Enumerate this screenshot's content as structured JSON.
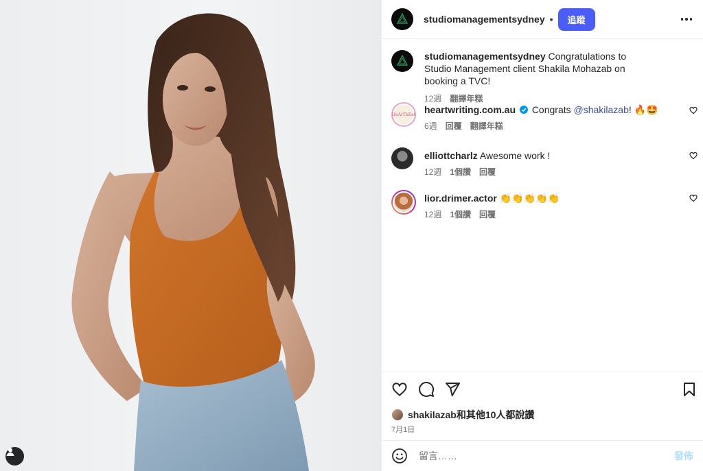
{
  "post": {
    "author": "studiomanagementsydney",
    "dot": "•",
    "follow_label": "追蹤",
    "caption_text": "Congratulations to Studio Management client Shakila Mohazab on booking a TVC!",
    "caption_time": "12週",
    "caption_translate": "翻譯年糕"
  },
  "comments": [
    {
      "user": "heartwriting.com.au",
      "verified": true,
      "text": "Congrats ",
      "mention": "@shakilazab",
      "suffix": "! 🔥🤩",
      "time": "6週",
      "reply": "回覆",
      "translate": "翻譯年糕",
      "avatar_label": "HeArTbEat"
    },
    {
      "user": "elliottcharlz",
      "text": "Awesome work !",
      "time": "12週",
      "likes": "1個讚",
      "reply": "回覆"
    },
    {
      "user": "lior.drimer.actor",
      "text": "👏👏👏👏👏",
      "time": "12週",
      "likes": "1個讚",
      "reply": "回覆"
    }
  ],
  "likes_line": {
    "user": "shakilazab",
    "rest": "和其他10人都說讚"
  },
  "post_date": "7月1日",
  "composer": {
    "placeholder": "留言……",
    "post_label": "發佈"
  },
  "icons": {
    "like": "heart-icon",
    "comment": "comment-icon",
    "share": "share-icon",
    "save": "bookmark-icon",
    "more": "more-icon",
    "emoji": "emoji-icon",
    "tag": "user-tag-icon"
  },
  "colors": {
    "follow_button": "#4a5df9",
    "mention": "#3b4fa8",
    "post_button_disabled": "#b2dffc",
    "verified": "#0095f6"
  }
}
